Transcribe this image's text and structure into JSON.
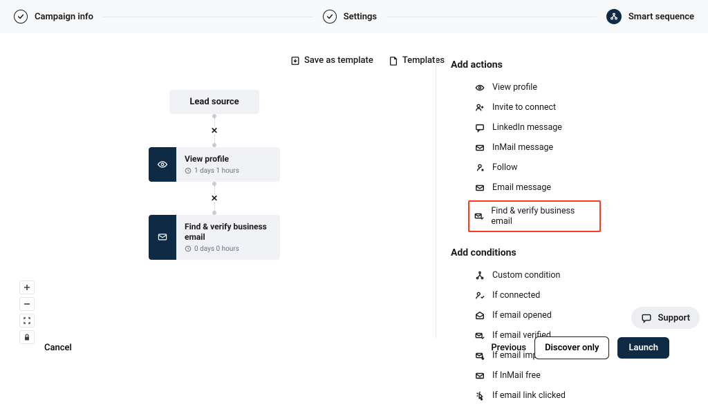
{
  "stepper": {
    "steps": [
      {
        "label": "Campaign info"
      },
      {
        "label": "Settings"
      },
      {
        "label": "Smart sequence"
      }
    ]
  },
  "toolbar": {
    "save_template_label": "Save as template",
    "templates_label": "Templates"
  },
  "canvas": {
    "lead_source_label": "Lead source",
    "cards": [
      {
        "title": "View profile",
        "delay": "1 days 1 hours"
      },
      {
        "title": "Find & verify business email",
        "delay": "0 days 0 hours"
      }
    ]
  },
  "sidebar": {
    "actions_heading": "Add actions",
    "actions": [
      {
        "label": "View profile",
        "icon": "eye"
      },
      {
        "label": "Invite to connect",
        "icon": "person-plus"
      },
      {
        "label": "LinkedIn message",
        "icon": "message"
      },
      {
        "label": "InMail message",
        "icon": "inmail"
      },
      {
        "label": "Follow",
        "icon": "follow"
      },
      {
        "label": "Email message",
        "icon": "email"
      },
      {
        "label": "Find & verify business email",
        "icon": "email-check",
        "highlighted": true
      }
    ],
    "conditions_heading": "Add conditions",
    "conditions": [
      {
        "label": "Custom condition",
        "icon": "branch"
      },
      {
        "label": "If connected",
        "icon": "person-check"
      },
      {
        "label": "If email opened",
        "icon": "email-open"
      },
      {
        "label": "If email verified",
        "icon": "email-verify"
      },
      {
        "label": "If email imported",
        "icon": "email-import"
      },
      {
        "label": "If InMail free",
        "icon": "inmail-free"
      },
      {
        "label": "If email link clicked",
        "icon": "link-click"
      }
    ]
  },
  "footer": {
    "cancel": "Cancel",
    "previous": "Previous",
    "discover": "Discover only",
    "launch": "Launch"
  },
  "support_label": "Support"
}
